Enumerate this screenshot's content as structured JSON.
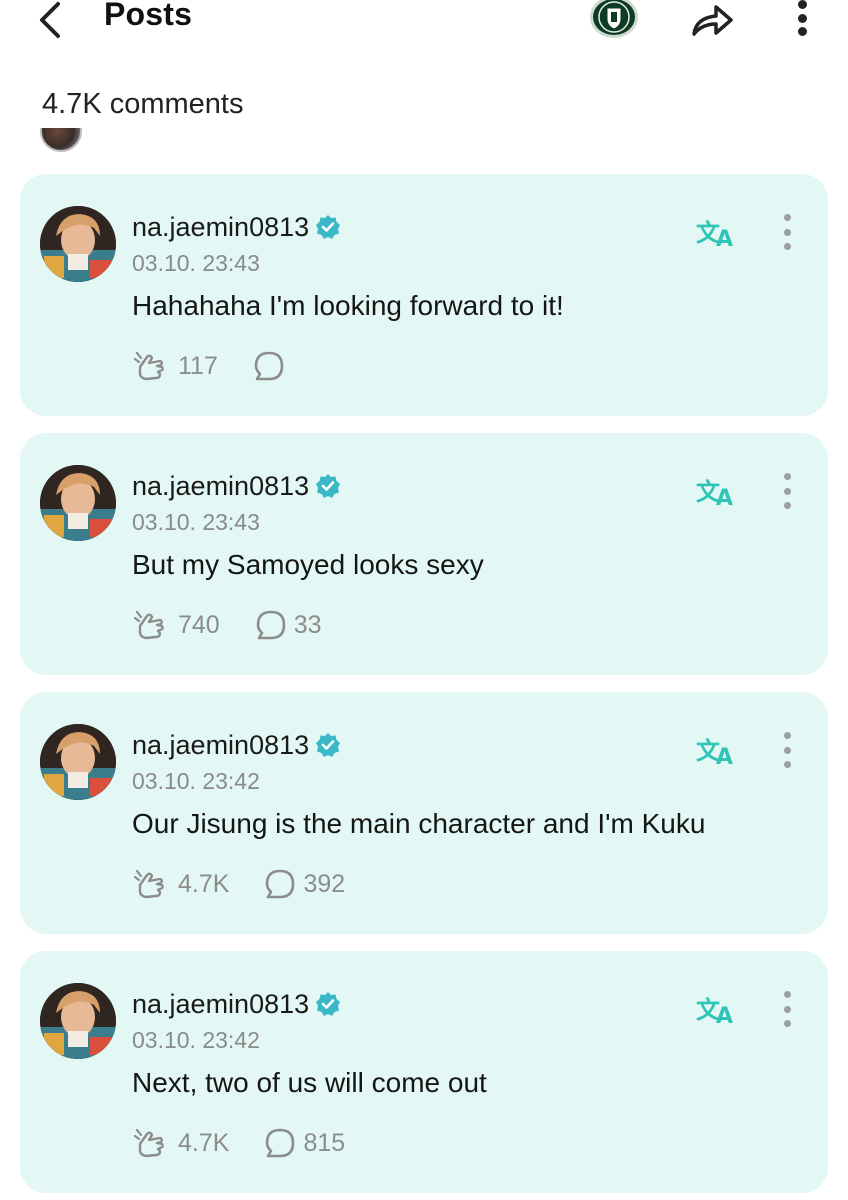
{
  "header": {
    "title": "Posts",
    "back_icon": "chevron-left-icon",
    "logo_icon": "community-crest-icon",
    "share_icon": "share-arrow-icon",
    "more_icon": "more-vertical-icon"
  },
  "comments_header": {
    "count_label": "4.7K comments"
  },
  "colors": {
    "card_background": "#e3f8f5",
    "accent": "#2ec4b6",
    "verified": "#3ab8c8",
    "muted_text": "#8a8a8a"
  },
  "comments": [
    {
      "username": "na.jaemin0813",
      "timestamp": "03.10. 23:43",
      "text": "Hahahaha I'm looking forward to it!",
      "likes": "117",
      "replies": ""
    },
    {
      "username": "na.jaemin0813",
      "timestamp": "03.10. 23:43",
      "text": "But my Samoyed looks sexy",
      "likes": "740",
      "replies": "33"
    },
    {
      "username": "na.jaemin0813",
      "timestamp": "03.10. 23:42",
      "text": "Our Jisung is the main character and I'm Kuku",
      "likes": "4.7K",
      "replies": "392"
    },
    {
      "username": "na.jaemin0813",
      "timestamp": "03.10. 23:42",
      "text": "Next, two of us will come out",
      "likes": "4.7K",
      "replies": "815"
    }
  ]
}
